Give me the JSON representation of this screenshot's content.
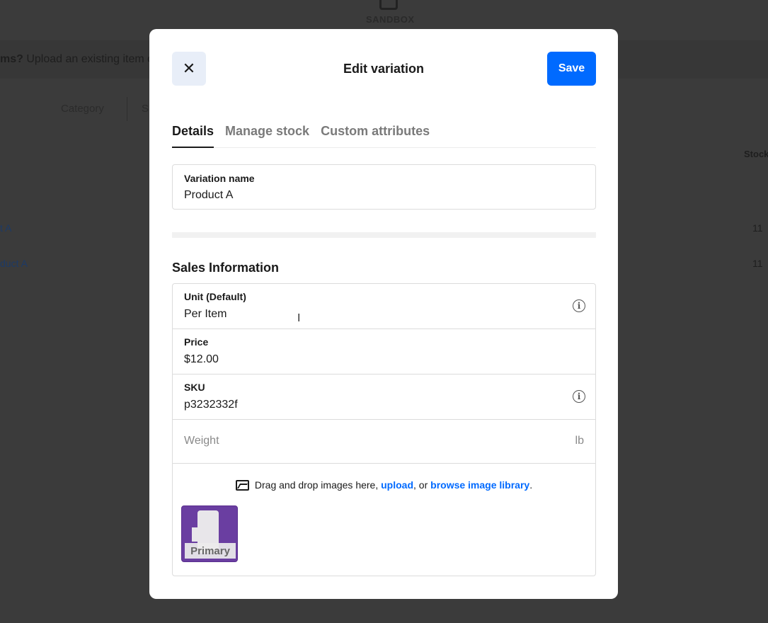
{
  "background": {
    "brand": "SANDBOX",
    "banner_text_bold": "ms?",
    "banner_text": " Upload an existing item c",
    "filter_category": "Category",
    "filter_other": "S",
    "column_stock": "Stock",
    "rows": [
      {
        "name": "t A",
        "stock": "11"
      },
      {
        "name": "duct A",
        "stock": "11"
      }
    ]
  },
  "modal": {
    "title": "Edit variation",
    "close_icon": "close-icon",
    "save_label": "Save",
    "accent_color": "#006aff",
    "tabs": [
      {
        "label": "Details",
        "active": true
      },
      {
        "label": "Manage stock",
        "active": false
      },
      {
        "label": "Custom attributes",
        "active": false
      }
    ],
    "variation_name": {
      "label": "Variation name",
      "value": "Product A"
    },
    "sales_section_title": "Sales Information",
    "unit": {
      "label": "Unit (Default)",
      "value": "Per Item"
    },
    "price": {
      "label": "Price",
      "value": "$12.00"
    },
    "sku": {
      "label": "SKU",
      "value": "p3232332f"
    },
    "weight": {
      "placeholder": "Weight",
      "unit": "lb"
    },
    "images": {
      "text_before": "Drag and drop images here, ",
      "upload_link": "upload",
      "text_middle": ", or ",
      "browse_link": "browse image library",
      "text_after": ".",
      "primary_label": "Primary"
    }
  }
}
